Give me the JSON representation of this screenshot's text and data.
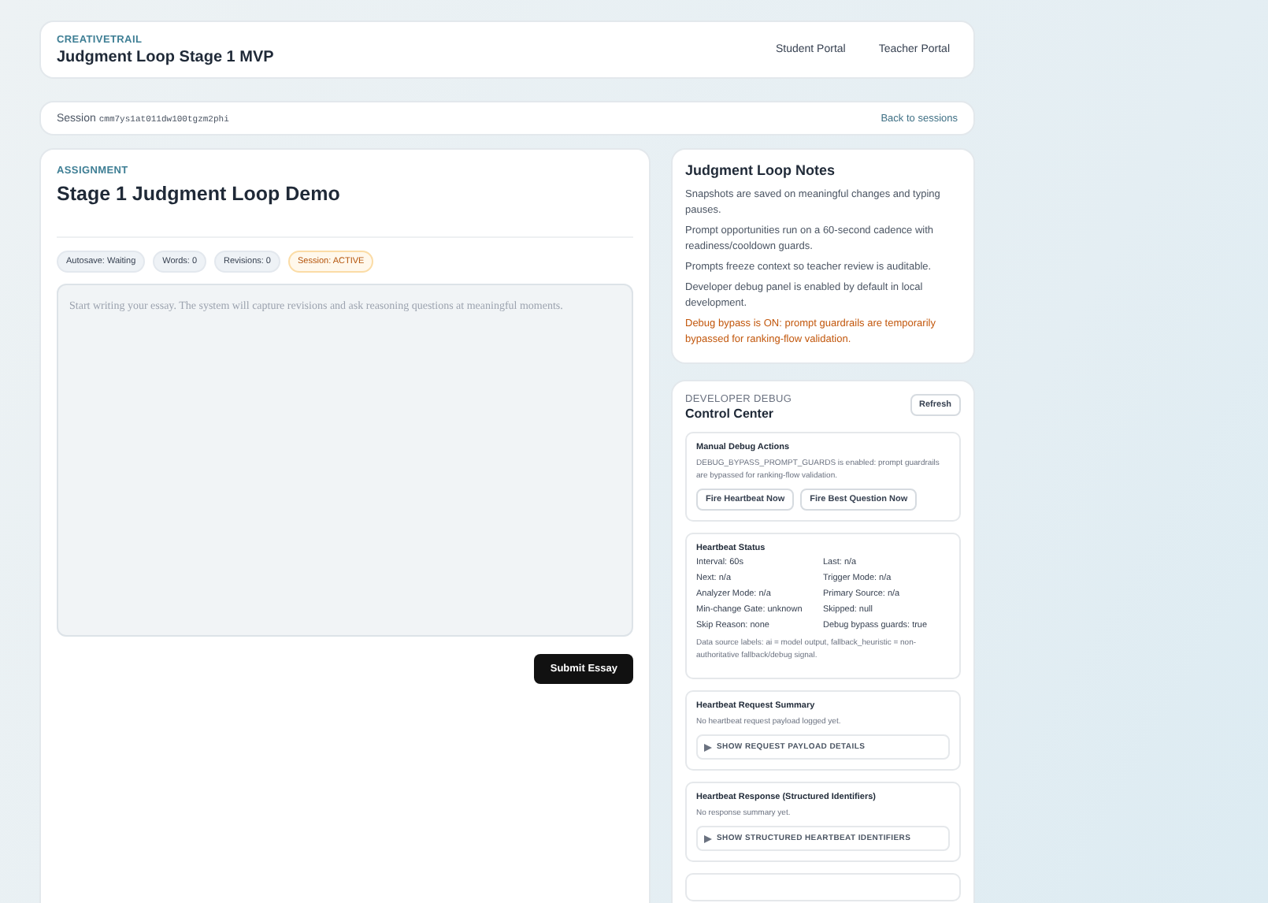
{
  "header": {
    "brand": "CREATIVETRAIL",
    "title": "Judgment Loop Stage 1 MVP",
    "nav": [
      "Student Portal",
      "Teacher Portal"
    ]
  },
  "session_bar": {
    "label": "Session",
    "id": "cmm7ys1at011dw100tgzm2phi",
    "link": "Back to sessions"
  },
  "assignment": {
    "eyebrow": "ASSIGNMENT",
    "title": "Stage 1 Judgment Loop Demo",
    "badges": [
      {
        "text": "Autosave: Waiting",
        "kind": "neutral"
      },
      {
        "text": "Words: 0",
        "kind": "neutral"
      },
      {
        "text": "Revisions: 0",
        "kind": "neutral"
      },
      {
        "text": "Session: ACTIVE",
        "kind": "warning"
      }
    ],
    "editor": {
      "placeholder": "Start writing your essay. The system will capture revisions and ask reasoning questions at meaningful moments."
    },
    "submit": "Submit Essay"
  },
  "notes": {
    "title": "Judgment Loop Notes",
    "items": [
      {
        "text": "Snapshots are saved on meaningful changes and typing pauses.",
        "kind": "normal"
      },
      {
        "text": "Prompt opportunities run on a 60-second cadence with readiness/cooldown guards.",
        "kind": "normal"
      },
      {
        "text": "Prompts freeze context so teacher review is auditable.",
        "kind": "normal"
      },
      {
        "text": "Developer debug panel is enabled by default in local development.",
        "kind": "normal"
      },
      {
        "text": "Debug bypass is ON: prompt guardrails are temporarily bypassed for ranking-flow validation.",
        "kind": "warning"
      }
    ]
  },
  "debug": {
    "eyebrow": "DEVELOPER DEBUG",
    "title": "Control Center",
    "refresh": "Refresh",
    "actions": {
      "title": "Manual Debug Actions",
      "text": "DEBUG_BYPASS_PROMPT_GUARDS is enabled: prompt guardrails are bypassed for ranking-flow validation.",
      "buttons": [
        "Fire Heartbeat Now",
        "Fire Best Question Now"
      ]
    },
    "status": {
      "title": "Heartbeat Status",
      "fields": [
        "Interval: 60s",
        "Last: n/a",
        "Next: n/a",
        "Trigger Mode: n/a",
        "Analyzer Mode: n/a",
        "Primary Source: n/a",
        "Min-change Gate: unknown",
        "Skipped: null",
        "Skip Reason: none",
        "Debug bypass guards: true"
      ],
      "note": "Data source labels: ai = model output, fallback_heuristic = non-authoritative fallback/debug signal."
    },
    "request": {
      "title": "Heartbeat Request Summary",
      "text": "No heartbeat request payload logged yet.",
      "details": "SHOW REQUEST PAYLOAD DETAILS"
    },
    "response": {
      "title": "Heartbeat Response (Structured Identifiers)",
      "text": "No response summary yet.",
      "details": "SHOW STRUCTURED HEARTBEAT IDENTIFIERS"
    }
  }
}
